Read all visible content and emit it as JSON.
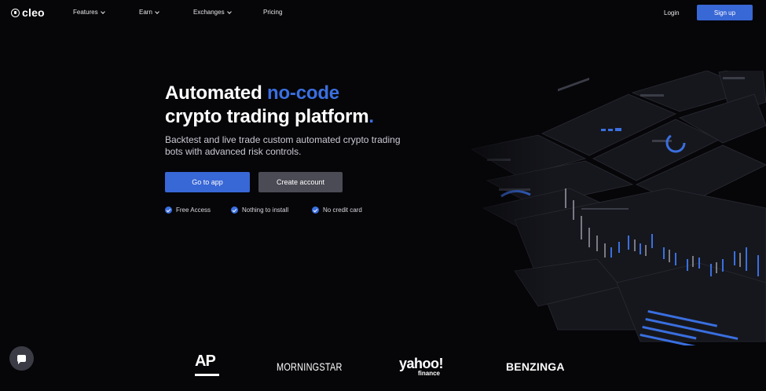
{
  "nav": {
    "logo": "cleo",
    "items": [
      {
        "label": "Features",
        "dropdown": true
      },
      {
        "label": "Earn",
        "dropdown": true
      },
      {
        "label": "Exchanges",
        "dropdown": true
      },
      {
        "label": "Pricing",
        "dropdown": false
      }
    ],
    "login": "Login",
    "signup": "Sign up"
  },
  "hero": {
    "title_part1": "Automated ",
    "title_accent": "no-code",
    "title_part2": "crypto trading platform",
    "title_dot": ".",
    "subtitle": "Backtest and live trade custom automated crypto trading bots with advanced risk controls.",
    "primary_cta": "Go to app",
    "secondary_cta": "Create account",
    "checks": [
      "Free Access",
      "Nothing to install",
      "No credit card"
    ]
  },
  "press": {
    "ap": "AP",
    "morningstar": "MORNINGSTAR",
    "yahoo": "yahoo!",
    "yahoo_sub": "finance",
    "benzinga": "BENZINGA"
  },
  "colors": {
    "background": "#060609",
    "accent": "#3a6fe0",
    "button_primary": "#3867d6",
    "button_secondary": "#4b4b55"
  },
  "icons": [
    "cleo-logo-icon",
    "chevron-down-icon",
    "check-circle-icon",
    "chat-icon"
  ]
}
